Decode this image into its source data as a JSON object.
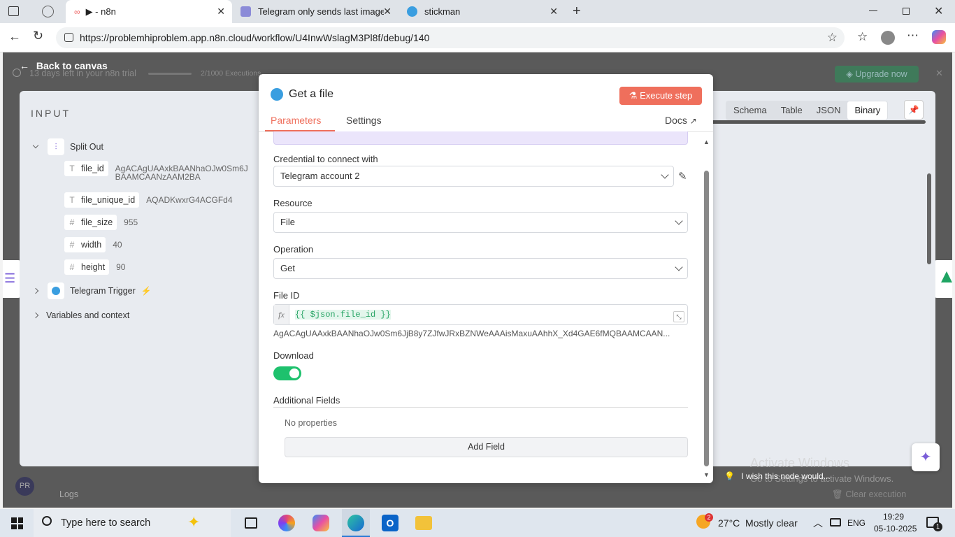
{
  "browser": {
    "tabs": [
      {
        "label": "▶ - n8n"
      },
      {
        "label": "Telegram only sends last image w"
      },
      {
        "label": "stickman"
      }
    ],
    "url": "https://problemhiproblem.app.n8n.cloud/workflow/U4InwWslagM3Pl8f/debug/140"
  },
  "header": {
    "back_label": "Back to canvas",
    "trial_text": "13 days left in your n8n trial",
    "executions_text": "2/1000 Executions",
    "upgrade_label": "Upgrade now"
  },
  "input_panel": {
    "title": "INPUT",
    "node_name": "Split Out",
    "fields": [
      {
        "type": "T",
        "name": "file_id",
        "value": "AgACAgUAAxkBAANhaOJw0Sm6J",
        "value2": "BAAMCAANzAAM2BA"
      },
      {
        "type": "T",
        "name": "file_unique_id",
        "value": "AQADKwxrG4ACGFd4"
      },
      {
        "type": "#",
        "name": "file_size",
        "value": "955"
      },
      {
        "type": "#",
        "name": "width",
        "value": "40"
      },
      {
        "type": "#",
        "name": "height",
        "value": "90"
      }
    ],
    "trigger_name": "Telegram Trigger",
    "vars_label": "Variables and context"
  },
  "modal": {
    "title": "Get a file",
    "execute_label": "Execute step",
    "tabs": [
      {
        "label": "Parameters"
      },
      {
        "label": "Settings"
      }
    ],
    "docs_label": "Docs",
    "credential_label": "Credential to connect with",
    "credential_value": "Telegram account 2",
    "resource_label": "Resource",
    "resource_value": "File",
    "operation_label": "Operation",
    "operation_value": "Get",
    "fileid_label": "File ID",
    "fx_label": "fx",
    "fileid_expression": "{{ $json.file_id }}",
    "fileid_preview": "AgACAgUAAxkBAANhaOJw0Sm6JjB8y7ZJfwJRxBZNWeAAAisMaxuAAhhX_Xd4GAE6fMQBAAMCAAN...",
    "download_label": "Download",
    "download_on": true,
    "additional_label": "Additional Fields",
    "no_props": "No properties",
    "add_field_label": "Add Field"
  },
  "output_panel": {
    "tabs": [
      {
        "label": "Schema"
      },
      {
        "label": "Table"
      },
      {
        "label": "JSON"
      },
      {
        "label": "Binary"
      }
    ],
    "active_tab": "Binary",
    "feedback_text": "I wish this node would..."
  },
  "bottom": {
    "logs_label": "Logs",
    "clear_label": "Clear execution",
    "avatar": "PR"
  },
  "watermark": {
    "line1": "Activate Windows",
    "line2": "Go to Settings to activate Windows."
  },
  "taskbar": {
    "search_placeholder": "Type here to search",
    "weather": "27°C  Mostly clear",
    "lang": "ENG",
    "time": "19:29",
    "date": "05-10-2025",
    "notif_count": "1",
    "weather_badge": "2"
  }
}
